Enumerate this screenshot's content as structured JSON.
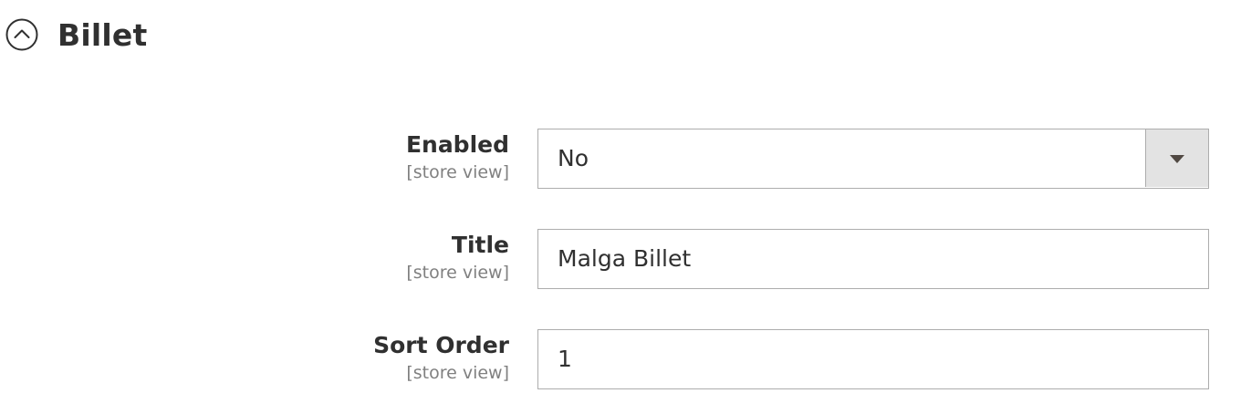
{
  "section": {
    "title": "Billet",
    "icon": "chevron-up-circle-icon"
  },
  "fields": {
    "enabled": {
      "label": "Enabled",
      "scope": "[store view]",
      "value": "No",
      "toggle_icon": "caret-down-icon"
    },
    "title": {
      "label": "Title",
      "scope": "[store view]",
      "value": "Malga Billet"
    },
    "sort_order": {
      "label": "Sort Order",
      "scope": "[store view]",
      "value": "1"
    }
  },
  "colors": {
    "text": "#303030",
    "scope_text": "#808080",
    "border": "#adadad",
    "select_toggle_bg": "#e3e3e3",
    "caret": "#514943"
  }
}
